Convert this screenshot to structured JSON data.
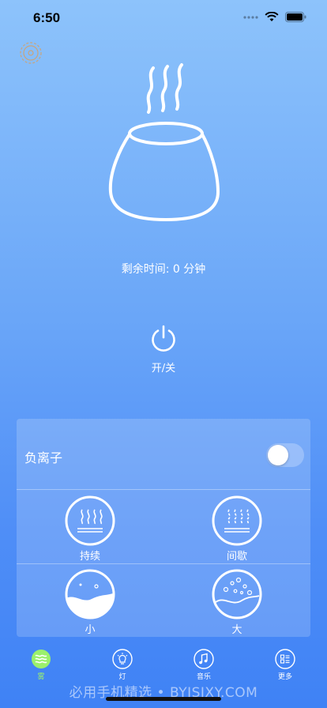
{
  "status_bar": {
    "time": "6:50"
  },
  "main": {
    "remaining_time": "剩余时间: 0 分钟",
    "power_label": "开/关"
  },
  "panel": {
    "anion_label": "负离子",
    "anion_on": false,
    "modes": [
      {
        "label": "持续",
        "icon": "continuous-mist-icon"
      },
      {
        "label": "间歇",
        "icon": "intermittent-mist-icon"
      },
      {
        "label": "小",
        "icon": "small-mist-icon"
      },
      {
        "label": "大",
        "icon": "large-mist-icon"
      }
    ]
  },
  "tabbar": {
    "tabs": [
      {
        "label": "雾",
        "icon": "mist-icon",
        "active": true
      },
      {
        "label": "灯",
        "icon": "bulb-icon",
        "active": false
      },
      {
        "label": "音乐",
        "icon": "music-note-icon",
        "active": false
      },
      {
        "label": "更多",
        "icon": "more-icon",
        "active": false
      }
    ]
  },
  "watermark": "必用手机精选 • BYJSJXY.COM",
  "colors": {
    "active_tab": "#9bf06c",
    "background_top": "#8dc3fb",
    "background_bottom": "#3f82f5"
  }
}
